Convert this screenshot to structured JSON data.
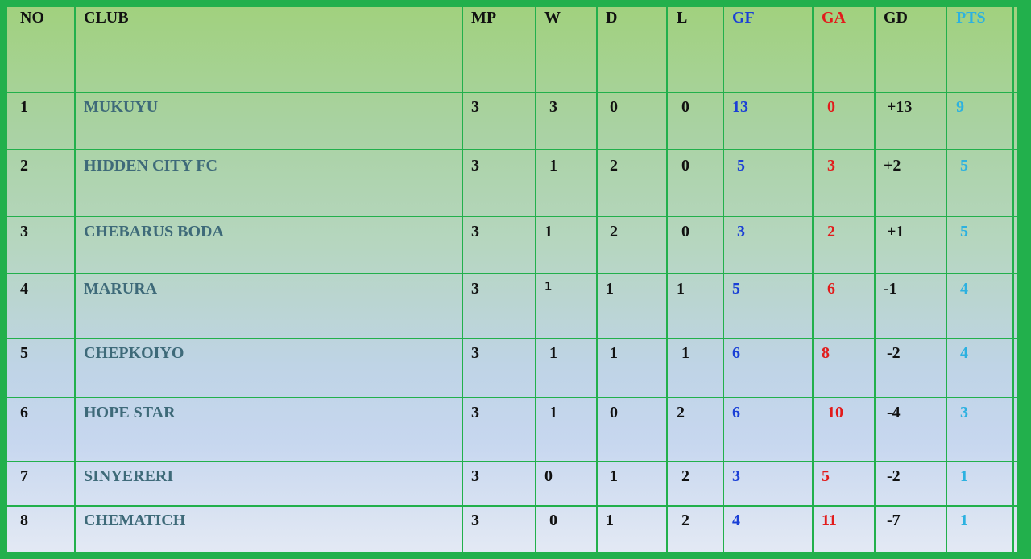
{
  "table": {
    "headers": {
      "no": "NO",
      "club": "CLUB",
      "mp": "MP",
      "w": "W",
      "d": "D",
      "l": "L",
      "gf": "GF",
      "ga": "GA",
      "gd": "GD",
      "pts": "PTS"
    },
    "rows": [
      {
        "no": "1",
        "club": "MUKUYU",
        "mp": "3",
        "w": "3",
        "d": "0",
        "l": "0",
        "gf": "13",
        "ga": "0",
        "gd": "+13",
        "pts": "9"
      },
      {
        "no": "2",
        "club": "HIDDEN CITY FC",
        "mp": "3",
        "w": "1",
        "d": "2",
        "l": "0",
        "gf": "5",
        "ga": "3",
        "gd": "+2",
        "pts": "5"
      },
      {
        "no": "3",
        "club": "CHEBARUS BODA",
        "mp": "3",
        "w": "1",
        "d": "2",
        "l": "0",
        "gf": "3",
        "ga": "2",
        "gd": "+1",
        "pts": "5"
      },
      {
        "no": "4",
        "club": "MARURA",
        "mp": "3",
        "w": "1",
        "d": "1",
        "l": "1",
        "gf": "5",
        "ga": "6",
        "gd": "-1",
        "pts": "4"
      },
      {
        "no": "5",
        "club": "CHEPKOIYO",
        "mp": "3",
        "w": "1",
        "d": "1",
        "l": "1",
        "gf": "6",
        "ga": "8",
        "gd": "-2",
        "pts": "4"
      },
      {
        "no": "6",
        "club": "HOPE STAR",
        "mp": "3",
        "w": "1",
        "d": "0",
        "l": "2",
        "gf": "6",
        "ga": "10",
        "gd": "-4",
        "pts": "3"
      },
      {
        "no": "7",
        "club": "SINYERERI",
        "mp": "3",
        "w": "0",
        "d": "1",
        "l": "2",
        "gf": "3",
        "ga": "5",
        "gd": "-2",
        "pts": "1"
      },
      {
        "no": "8",
        "club": "CHEMATICH",
        "mp": "3",
        "w": "0",
        "d": "1",
        "l": "2",
        "gf": "4",
        "ga": "11",
        "gd": "-7",
        "pts": "1"
      }
    ]
  },
  "colors": {
    "border_green": "#22b04c",
    "club_text": "#3e6a79",
    "gf_blue": "#1a3fd6",
    "ga_red": "#e21b1b",
    "pts_cyan": "#2cb1e0"
  }
}
